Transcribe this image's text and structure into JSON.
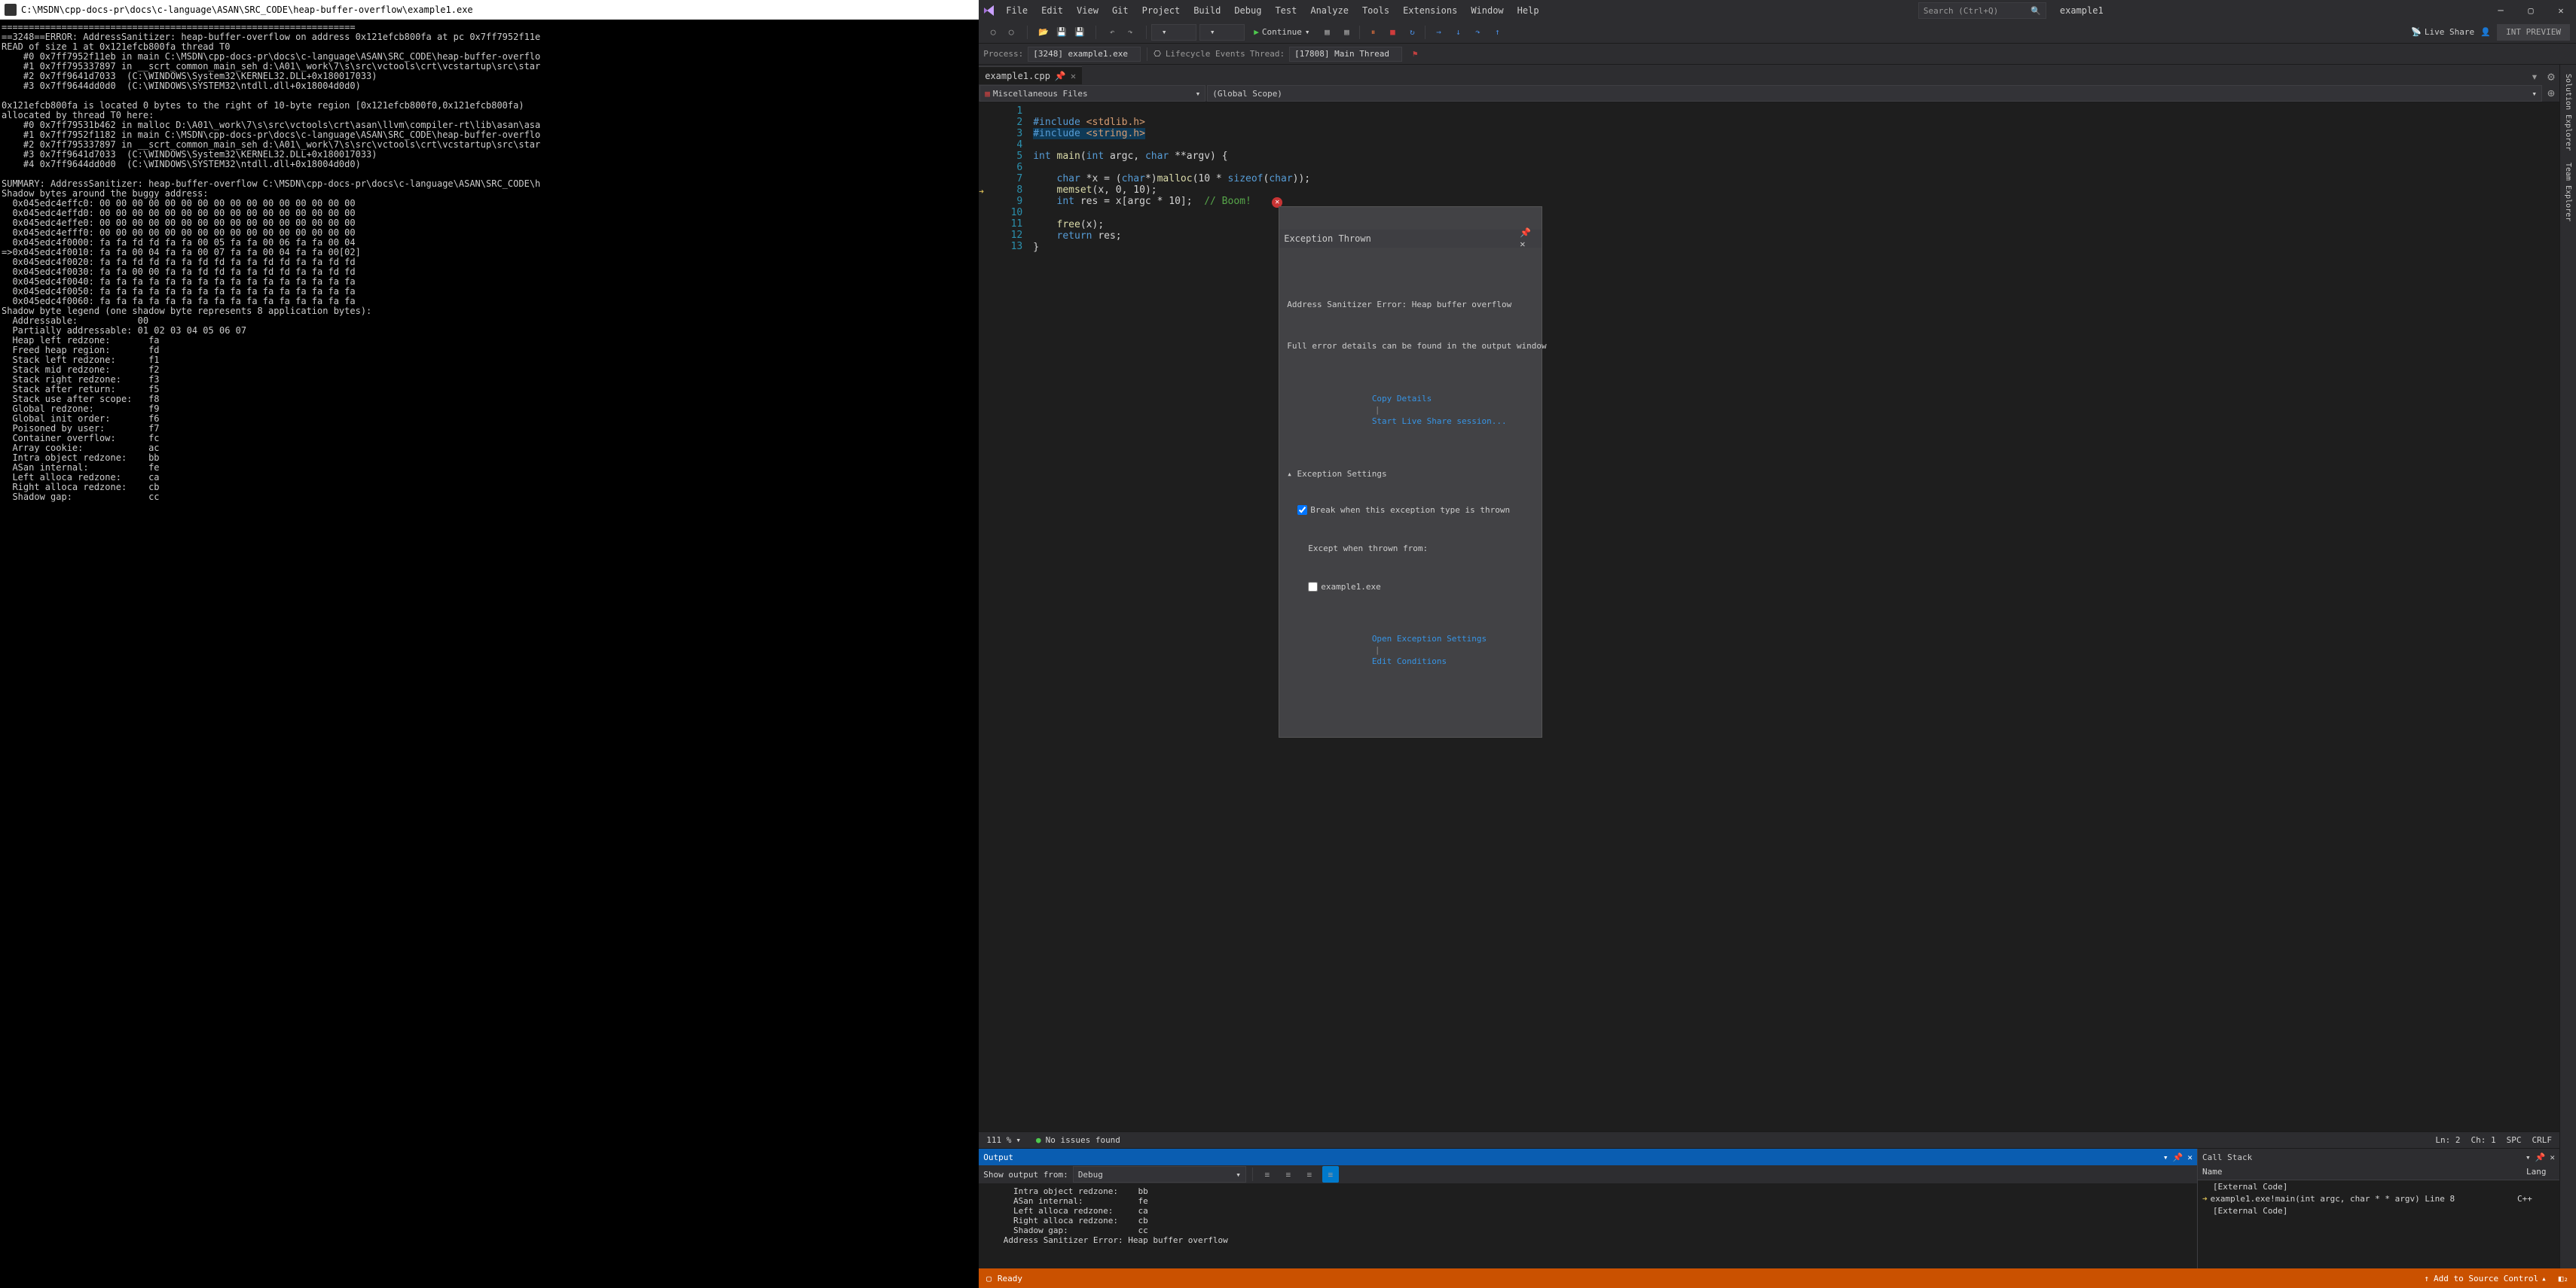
{
  "console": {
    "title": "C:\\MSDN\\cpp-docs-pr\\docs\\c-language\\ASAN\\SRC_CODE\\heap-buffer-overflow\\example1.exe",
    "lines": [
      "=================================================================",
      "==3248==ERROR: AddressSanitizer: heap-buffer-overflow on address 0x121efcb800fa at pc 0x7ff7952f11e",
      "READ of size 1 at 0x121efcb800fa thread T0",
      "    #0 0x7ff7952f11eb in main C:\\MSDN\\cpp-docs-pr\\docs\\c-language\\ASAN\\SRC_CODE\\heap-buffer-overflo",
      "    #1 0x7ff795337897 in __scrt_common_main_seh d:\\A01\\_work\\7\\s\\src\\vctools\\crt\\vcstartup\\src\\star",
      "    #2 0x7ff9641d7033  (C:\\WINDOWS\\System32\\KERNEL32.DLL+0x180017033)",
      "    #3 0x7ff9644dd0d0  (C:\\WINDOWS\\SYSTEM32\\ntdll.dll+0x18004d0d0)",
      "",
      "0x121efcb800fa is located 0 bytes to the right of 10-byte region [0x121efcb800f0,0x121efcb800fa)",
      "allocated by thread T0 here:",
      "    #0 0x7ff79531b462 in malloc D:\\A01\\_work\\7\\s\\src\\vctools\\crt\\asan\\llvm\\compiler-rt\\lib\\asan\\asa",
      "    #1 0x7ff7952f1182 in main C:\\MSDN\\cpp-docs-pr\\docs\\c-language\\ASAN\\SRC_CODE\\heap-buffer-overflo",
      "    #2 0x7ff795337897 in __scrt_common_main_seh d:\\A01\\_work\\7\\s\\src\\vctools\\crt\\vcstartup\\src\\star",
      "    #3 0x7ff9641d7033  (C:\\WINDOWS\\System32\\KERNEL32.DLL+0x180017033)",
      "    #4 0x7ff9644dd0d0  (C:\\WINDOWS\\SYSTEM32\\ntdll.dll+0x18004d0d0)",
      "",
      "SUMMARY: AddressSanitizer: heap-buffer-overflow C:\\MSDN\\cpp-docs-pr\\docs\\c-language\\ASAN\\SRC_CODE\\h",
      "Shadow bytes around the buggy address:",
      "  0x045edc4effc0: 00 00 00 00 00 00 00 00 00 00 00 00 00 00 00 00",
      "  0x045edc4effd0: 00 00 00 00 00 00 00 00 00 00 00 00 00 00 00 00",
      "  0x045edc4effe0: 00 00 00 00 00 00 00 00 00 00 00 00 00 00 00 00",
      "  0x045edc4efff0: 00 00 00 00 00 00 00 00 00 00 00 00 00 00 00 00",
      "  0x045edc4f0000: fa fa fd fd fa fa 00 05 fa fa 00 06 fa fa 00 04",
      "=>0x045edc4f0010: fa fa 00 04 fa fa 00 07 fa fa 00 04 fa fa 00[02]",
      "  0x045edc4f0020: fa fa fd fd fa fa fd fd fa fa fd fd fa fa fd fd",
      "  0x045edc4f0030: fa fa 00 00 fa fa fd fd fa fa fd fd fa fa fd fd",
      "  0x045edc4f0040: fa fa fa fa fa fa fa fa fa fa fa fa fa fa fa fa",
      "  0x045edc4f0050: fa fa fa fa fa fa fa fa fa fa fa fa fa fa fa fa",
      "  0x045edc4f0060: fa fa fa fa fa fa fa fa fa fa fa fa fa fa fa fa",
      "Shadow byte legend (one shadow byte represents 8 application bytes):",
      "  Addressable:           00",
      "  Partially addressable: 01 02 03 04 05 06 07",
      "  Heap left redzone:       fa",
      "  Freed heap region:       fd",
      "  Stack left redzone:      f1",
      "  Stack mid redzone:       f2",
      "  Stack right redzone:     f3",
      "  Stack after return:      f5",
      "  Stack use after scope:   f8",
      "  Global redzone:          f9",
      "  Global init order:       f6",
      "  Poisoned by user:        f7",
      "  Container overflow:      fc",
      "  Array cookie:            ac",
      "  Intra object redzone:    bb",
      "  ASan internal:           fe",
      "  Left alloca redzone:     ca",
      "  Right alloca redzone:    cb",
      "  Shadow gap:              cc"
    ]
  },
  "vs": {
    "menus": [
      "File",
      "Edit",
      "View",
      "Git",
      "Project",
      "Build",
      "Debug",
      "Test",
      "Analyze",
      "Tools",
      "Extensions",
      "Window",
      "Help"
    ],
    "search_placeholder": "Search (Ctrl+Q)",
    "solution": "example1",
    "preview_btn": "INT PREVIEW",
    "continue": "Continue",
    "liveshare": "Live Share",
    "process_label": "Process:",
    "process_value": "[3248] example1.exe",
    "lifecycle": "Lifecycle Events",
    "thread_label": "Thread:",
    "thread_value": "[17808] Main Thread",
    "tab": "example1.cpp",
    "nav1": "Miscellaneous Files",
    "nav2": "(Global Scope)",
    "lines": [
      "1",
      "2",
      "3",
      "4",
      "5",
      "6",
      "7",
      "8",
      "9",
      "10",
      "11",
      "12",
      "13"
    ],
    "status": {
      "zoom": "111 %",
      "issues": "No issues found",
      "ln": "Ln: 2",
      "ch": "Ch: 1",
      "spc": "SPC",
      "crlf": "CRLF"
    },
    "exception": {
      "title": "Exception Thrown",
      "msg": "Address Sanitizer Error: Heap buffer overflow",
      "detail": "Full error details can be found in the output window",
      "copy": "Copy Details",
      "share": "Start Live Share session...",
      "settings": "Exception Settings",
      "break": "Break when this exception type is thrown",
      "except": "Except when thrown from:",
      "exe": "example1.exe",
      "open": "Open Exception Settings",
      "edit": "Edit Conditions"
    },
    "output": {
      "title": "Output",
      "show_label": "Show output from:",
      "show_value": "Debug",
      "content": "      Intra object redzone:    bb\n      ASan internal:           fe\n      Left alloca redzone:     ca\n      Right alloca redzone:    cb\n      Shadow gap:              cc\n    Address Sanitizer Error: Heap buffer overflow"
    },
    "callstack": {
      "title": "Call Stack",
      "col_name": "Name",
      "col_lang": "Lang",
      "rows": [
        {
          "name": "[External Code]",
          "lang": ""
        },
        {
          "name": "example1.exe!main(int argc, char * * argv) Line 8",
          "lang": "C++"
        },
        {
          "name": "[External Code]",
          "lang": ""
        }
      ]
    },
    "side": [
      "Solution Explorer",
      "Team Explorer"
    ],
    "bottombar": {
      "ready": "Ready",
      "add": "Add to Source Control"
    }
  }
}
